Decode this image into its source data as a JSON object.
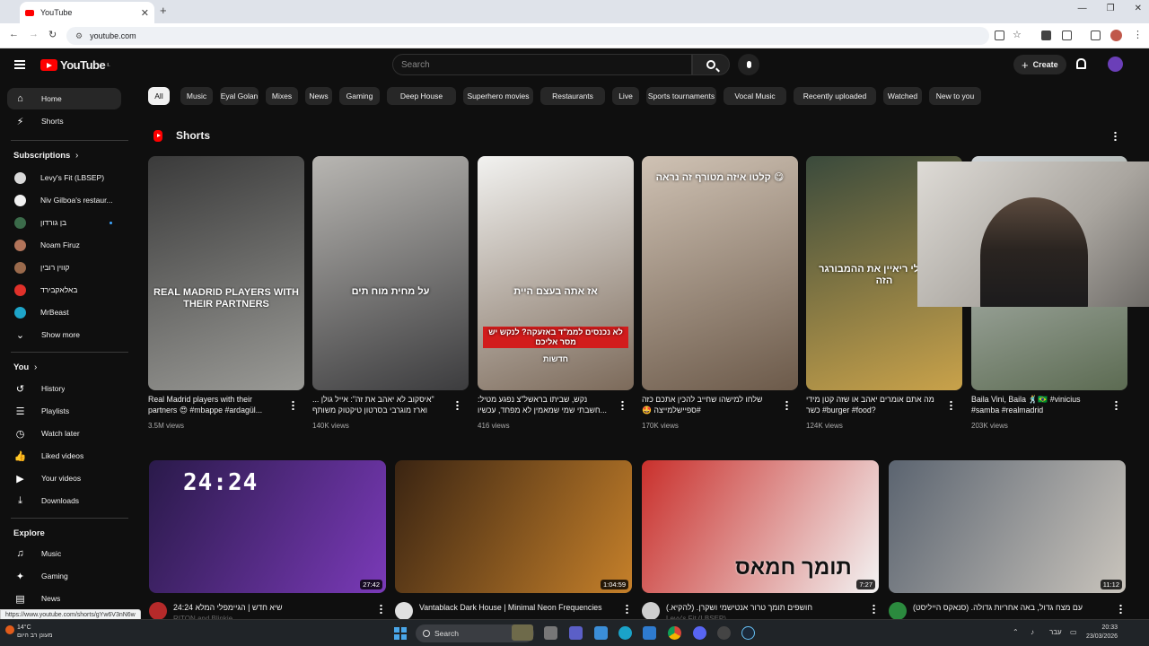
{
  "browser": {
    "tab_title": "YouTube",
    "url": "youtube.com"
  },
  "header": {
    "logo_text": "YouTube",
    "region": "IL",
    "search_placeholder": "Search",
    "create_label": "Create"
  },
  "sidebar": {
    "main": [
      {
        "label": "Home",
        "icon": "home-icon",
        "active": true
      },
      {
        "label": "Shorts",
        "icon": "shorts-icon"
      }
    ],
    "subscriptions_heading": "Subscriptions",
    "subscriptions": [
      {
        "label": "Levy's Fit (LBSEP)",
        "color": "#d9d9d9"
      },
      {
        "label": "Niv Gilboa's restaur...",
        "color": "#f1f1f1"
      },
      {
        "label": "בן גורדון",
        "color": "#3b6b4a",
        "live": true
      },
      {
        "label": "Noam Firuz",
        "color": "#b2745a"
      },
      {
        "label": "קווין רובין",
        "color": "#9a6a4c"
      },
      {
        "label": "באלאקבירד",
        "color": "#e0312a"
      },
      {
        "label": "MrBeast",
        "color": "#1ea5c9"
      }
    ],
    "show_more": "Show more",
    "you_heading": "You",
    "you_items": [
      {
        "label": "History",
        "icon": "history-icon"
      },
      {
        "label": "Playlists",
        "icon": "playlists-icon"
      },
      {
        "label": "Watch later",
        "icon": "watch-later-icon"
      },
      {
        "label": "Liked videos",
        "icon": "liked-icon"
      },
      {
        "label": "Your videos",
        "icon": "your-videos-icon"
      },
      {
        "label": "Downloads",
        "icon": "downloads-icon"
      }
    ],
    "explore_heading": "Explore",
    "explore_items": [
      {
        "label": "Music",
        "icon": "music-icon"
      },
      {
        "label": "Gaming",
        "icon": "gaming-icon"
      },
      {
        "label": "News",
        "icon": "news-icon"
      }
    ]
  },
  "chips": [
    "All",
    "Music",
    "Eyal Golan",
    "Mixes",
    "News",
    "Gaming",
    "Deep House",
    "Superhero movies",
    "Restaurants",
    "Live",
    "Sports tournaments",
    "Vocal Music",
    "Recently uploaded",
    "Watched",
    "New to you"
  ],
  "shorts": {
    "heading": "Shorts",
    "items": [
      {
        "title": "Real Madrid players with their partners 😍 #mbappe #ardagül...",
        "views": "3.5M views",
        "overlay": "REAL MADRID PLAYERS WITH THEIR PARTNERS",
        "colors": [
          "#3a3a3a",
          "#9a9a96"
        ]
      },
      {
        "title": "\"איסקוב לא יאהב את זה\": אייל גולן ... וארז מוגרבי בסרטון טיקטוק משותף",
        "views": "140K views",
        "overlay": "על מחית מוח תים",
        "colors": [
          "#b8b6b2",
          "#3c3c3e"
        ]
      },
      {
        "title": "נקש, שביתו בראשל\"צ נפגע מטיל: ...חשבתי שמי שמאמין לא מפחד, עכשיו",
        "views": "416 views",
        "overlay": "אז אתה בעצם היית",
        "band": "לא נכנסים לממ\"ד באזעקה? לנקש יש מסר אליכם",
        "brand": "חדשות",
        "colors": [
          "#f2f2f0",
          "#7c6a5a"
        ]
      },
      {
        "title": "שלחו למישהו שחייב להכין אתכם כזה #ספיישלמייצה 🤩",
        "views": "170K views",
        "overlay": "קלטו איזה מטורף זה נראה 😋",
        "colors": [
          "#cfc2b4",
          "#6c5a4a"
        ]
      },
      {
        "title": "מה אתם אומרים יאהב או שזה קטן מידי ?burger #food# כשר",
        "views": "124K views",
        "overlay": "אבא שלי ריאיין את ההמבורגר הזה",
        "colors": [
          "#3a4a3c",
          "#c9a24a"
        ]
      },
      {
        "title": "Baila Vini, Baila 🕺🇧🇷 #vinicius #samba #realmadrid",
        "views": "203K views",
        "colors": [
          "#cfd3d6",
          "#5c6b52"
        ]
      }
    ]
  },
  "videos": [
    {
      "title": "שיא חדש | הגיימפלי המלא 24:24",
      "channel": "RITON and Blinkie",
      "duration": "27:42",
      "overlay": "24:24",
      "avatar": "#b52a2a",
      "colors": [
        "#2a1a4a",
        "#7a3ab8"
      ]
    },
    {
      "title": "Vantablack Dark House | Minimal Neon Frequencies",
      "channel": "",
      "duration": "1:04:59",
      "avatar": "#e0e0e0",
      "colors": [
        "#3a2412",
        "#c5802a"
      ]
    },
    {
      "title": "חושפים תומך טרור אנטישמי ושקרן. (להקיא.)",
      "channel": "Levy's Fit (LBSEP)",
      "duration": "7:27",
      "overlay": "תומך חמאס",
      "avatar": "#cfcfcf",
      "colors": [
        "#c9302c",
        "#f3f3f3"
      ]
    },
    {
      "title": "עם מצח גדול, באה אחריות גדולה. (סנאקס הייליסט)",
      "channel": "",
      "duration": "11:12",
      "avatar": "#2b8a3e",
      "colors": [
        "#5b6470",
        "#c9c4bc"
      ]
    }
  ],
  "status_bar_url": "https://www.youtube.com/shorts/gYw6V3nN6w",
  "taskbar": {
    "temperature": "14°C",
    "weather_text": "מעונן רב היום",
    "search_label": "Search",
    "language": "עבר",
    "time": "20:33",
    "date": "23/03/2026"
  }
}
